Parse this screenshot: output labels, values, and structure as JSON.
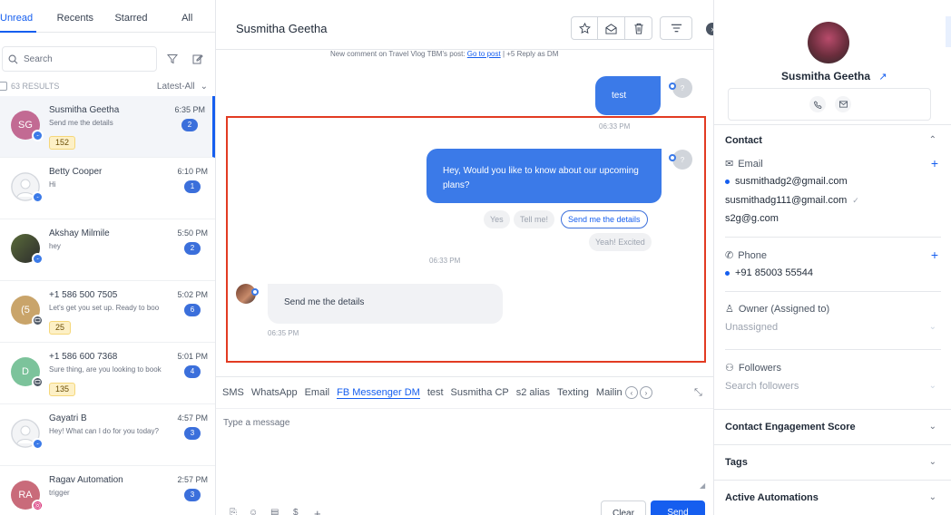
{
  "left": {
    "tabs": [
      "Unread",
      "Recents",
      "Starred",
      "All"
    ],
    "search_placeholder": "Search",
    "results": "63 RESULTS",
    "sort": "Latest-All",
    "conversations": [
      {
        "name": "Susmitha Geetha",
        "preview": "Send me the details",
        "time": "6:35 PM",
        "count": "2",
        "tag": "152",
        "initials": "SG",
        "avatar_color": "#c26a93",
        "channel": "messenger"
      },
      {
        "name": "Betty Cooper",
        "preview": "Hi",
        "time": "6:10 PM",
        "count": "1",
        "tag": "",
        "initials": "",
        "avatar_color": "#d1d5db",
        "channel": "messenger"
      },
      {
        "name": "Akshay Milmile",
        "preview": "hey",
        "time": "5:50 PM",
        "count": "2",
        "tag": "",
        "initials": "",
        "avatar_color": "#5a6b3a",
        "channel": "messenger"
      },
      {
        "name": "+1 586 500 7505",
        "preview": "Let's get you set up. Ready to boo",
        "time": "5:02 PM",
        "count": "6",
        "tag": "25",
        "initials": "(5",
        "avatar_color": "#c9a46a",
        "channel": "sms"
      },
      {
        "name": "+1 586 600 7368",
        "preview": "Sure thing, are you looking to book",
        "time": "5:01 PM",
        "count": "4",
        "tag": "135",
        "initials": "D",
        "avatar_color": "#7cc39b",
        "channel": "sms"
      },
      {
        "name": "Gayatri B",
        "preview": "Hey! What can I do for you today?",
        "time": "4:57 PM",
        "count": "3",
        "tag": "",
        "initials": "",
        "avatar_color": "#d1d5db",
        "channel": "messenger"
      },
      {
        "name": "Ragav Automation",
        "preview": "trigger",
        "time": "2:57 PM",
        "count": "3",
        "tag": "",
        "initials": "RA",
        "avatar_color": "#c96b7a",
        "channel": "instagram"
      }
    ]
  },
  "mid": {
    "title": "Susmitha Geetha",
    "system_line_prefix": "New comment on Travel Vlog TBM's post:",
    "system_line_link": "Go to post",
    "system_line_suffix": "| +5 Reply as DM",
    "msg1": "test",
    "msg1_time": "06:33 PM",
    "msg2": "Hey, Would you like to know about our upcoming plans?",
    "quick_replies": [
      "Yes",
      "Tell me!",
      "Send me the details"
    ],
    "quick_reply_extra": "Yeah! Excited",
    "msg2_time": "06:33 PM",
    "msg3": "Send me the details",
    "msg3_time": "06:35 PM",
    "agent_initial": "?",
    "channels": [
      "SMS",
      "WhatsApp",
      "Email",
      "FB Messenger DM",
      "test",
      "Susmitha CP",
      "s2 alias",
      "Texting",
      "Mailin"
    ],
    "message_placeholder": "Type a message",
    "clear_label": "Clear",
    "send_label": "Send"
  },
  "right": {
    "name": "Susmitha Geetha",
    "contact_title": "Contact",
    "email_label": "Email",
    "emails": [
      "susmithadg2@gmail.com",
      "susmithadg111@gmail.com",
      "s2g@g.com"
    ],
    "phone_label": "Phone",
    "phone": "+91 85003 55544",
    "owner_label": "Owner (Assigned to)",
    "owner_value": "Unassigned",
    "followers_label": "Followers",
    "followers_placeholder": "Search followers",
    "engagement_title": "Contact Engagement Score",
    "tags_title": "Tags",
    "automations_title": "Active Automations"
  },
  "colors": {
    "accent": "#155eef",
    "outgoing_bubble": "#3b7ae8",
    "highlight": "#e23b22"
  }
}
